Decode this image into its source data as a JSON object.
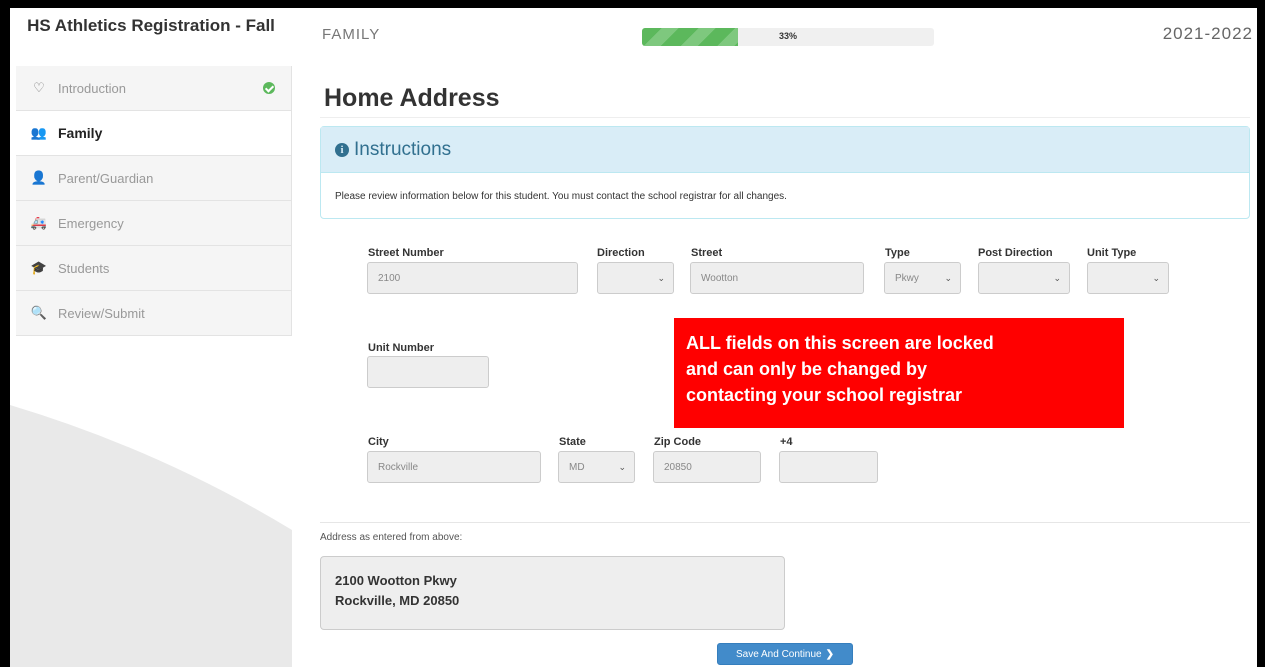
{
  "sidebar": {
    "title": "HS Athletics Registration - Fall",
    "items": [
      {
        "label": "Introduction",
        "icon": "lightbulb-icon",
        "glyph": "♡",
        "completed": true
      },
      {
        "label": "Family",
        "icon": "family-icon",
        "glyph": "👥",
        "active": true
      },
      {
        "label": "Parent/Guardian",
        "icon": "user-icon",
        "glyph": "👤"
      },
      {
        "label": "Emergency",
        "icon": "ambulance-icon",
        "glyph": "🚑"
      },
      {
        "label": "Students",
        "icon": "graduation-cap-icon",
        "glyph": "🎓"
      },
      {
        "label": "Review/Submit",
        "icon": "search-icon",
        "glyph": "🔍"
      }
    ]
  },
  "header": {
    "section": "FAMILY",
    "progress_percent": 33,
    "progress_label": "33%",
    "year": "2021-2022"
  },
  "main": {
    "title": "Home Address",
    "instructions": {
      "heading": "Instructions",
      "text": "Please review information below for this student. You must contact the school registrar for all changes."
    },
    "fields": {
      "street_number": {
        "label": "Street Number",
        "value": "2100"
      },
      "direction": {
        "label": "Direction",
        "value": ""
      },
      "street": {
        "label": "Street",
        "value": "Wootton"
      },
      "type": {
        "label": "Type",
        "value": "Pkwy"
      },
      "post_direction": {
        "label": "Post Direction",
        "value": ""
      },
      "unit_type": {
        "label": "Unit Type",
        "value": ""
      },
      "unit_number": {
        "label": "Unit Number",
        "value": ""
      },
      "city": {
        "label": "City",
        "value": "Rockville"
      },
      "state": {
        "label": "State",
        "value": "MD"
      },
      "zip": {
        "label": "Zip Code",
        "value": "20850"
      },
      "plus4": {
        "label": "+4",
        "value": ""
      }
    },
    "alert": {
      "line1": "ALL fields on this screen are locked",
      "line2": "and can only be changed by",
      "line3": "contacting your school registrar"
    },
    "address_caption": "Address as entered from above:",
    "address_line1": "2100 Wootton Pkwy",
    "address_line2": "Rockville, MD 20850",
    "save_label": "Save And Continue",
    "save_arrow": "❯"
  },
  "colors": {
    "alert": "#ff0000",
    "progress": "#5cb85c",
    "info": "#31708f",
    "button": "#428bca"
  }
}
